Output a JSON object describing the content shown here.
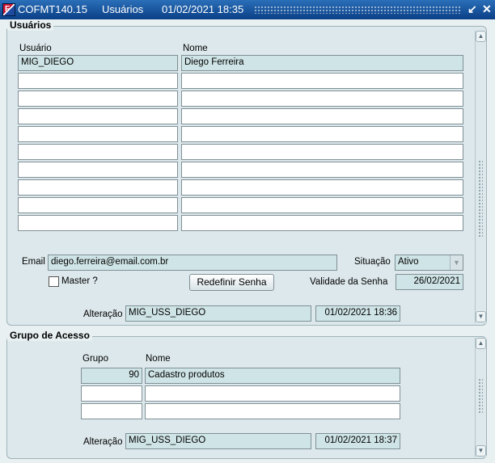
{
  "window": {
    "form_code": "COFMT140.15",
    "title": "Usuários",
    "datetime": "01/02/2021 18:35",
    "icon_name": "oracle-forms-icon",
    "minimize_glyph": "↙",
    "close_glyph": "✕"
  },
  "usuarios": {
    "section_title": "Usuários",
    "col_usuario": "Usuário",
    "col_nome": "Nome",
    "rows": [
      {
        "usuario": "MIG_DIEGO",
        "nome": "Diego Ferreira"
      },
      {
        "usuario": "",
        "nome": ""
      },
      {
        "usuario": "",
        "nome": ""
      },
      {
        "usuario": "",
        "nome": ""
      },
      {
        "usuario": "",
        "nome": ""
      },
      {
        "usuario": "",
        "nome": ""
      },
      {
        "usuario": "",
        "nome": ""
      },
      {
        "usuario": "",
        "nome": ""
      },
      {
        "usuario": "",
        "nome": ""
      },
      {
        "usuario": "",
        "nome": ""
      }
    ],
    "email_label": "Email",
    "email_value": "diego.ferreira@email.com.br",
    "situacao_label": "Situação",
    "situacao_value": "Ativo",
    "master_label": "Master ?",
    "master_checked": false,
    "reset_button": "Redefinir Senha",
    "validade_label": "Validade da Senha",
    "validade_value": "26/02/2021",
    "alteracao_label": "Alteração",
    "alteracao_user": "MIG_USS_DIEGO",
    "alteracao_date": "01/02/2021 18:36"
  },
  "grupo": {
    "section_title": "Grupo de Acesso",
    "col_grupo": "Grupo",
    "col_nome": "Nome",
    "rows": [
      {
        "grupo": "90",
        "nome": "Cadastro produtos"
      },
      {
        "grupo": "",
        "nome": ""
      },
      {
        "grupo": "",
        "nome": ""
      }
    ],
    "alteracao_label": "Alteração",
    "alteracao_user": "MIG_USS_DIEGO",
    "alteracao_date": "01/02/2021 18:37"
  },
  "colors": {
    "titlebar": "#0b3f86",
    "panel": "#dde8ec",
    "readonly_field": "#cfe4e6"
  }
}
